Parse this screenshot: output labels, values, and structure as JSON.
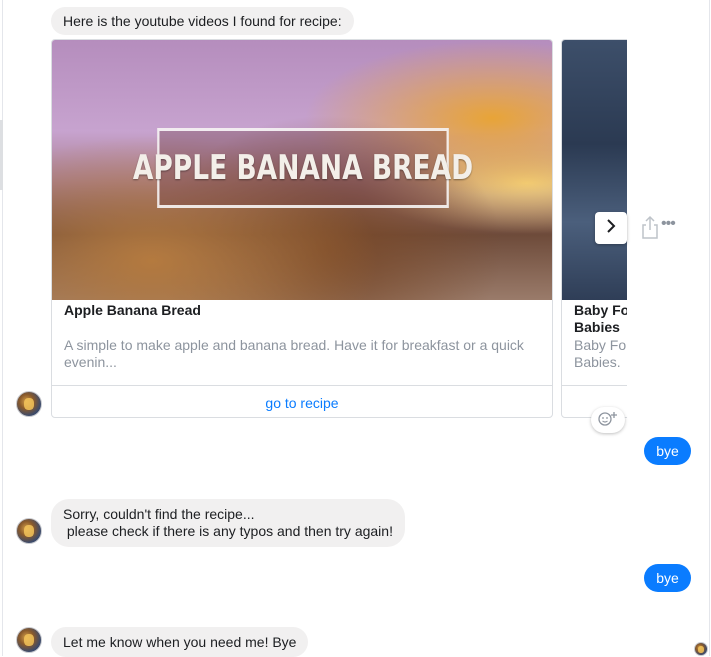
{
  "colors": {
    "incoming_bubble": "#f1f0f0",
    "outgoing_bubble": "#0a7cff",
    "link": "#0a7cff",
    "muted_text": "#8d949e"
  },
  "messages": {
    "intro": "Here is the youtube videos I found for recipe:",
    "bye_1": "bye",
    "not_found": "Sorry, couldn't find the recipe...\n please check if there is any typos and then try again!",
    "bye_2": "bye",
    "farewell": "Let me know when you need me! Bye"
  },
  "carousel": {
    "cards": [
      {
        "image_overlay_text": "APPLE BANANA BREAD",
        "title": "Apple Banana Bread",
        "description": "A simple to make apple and banana bread. Have it for breakfast or a quick evenin...",
        "action_label": "go to recipe"
      },
      {
        "title": "Baby Fo Babies",
        "description": "Baby Fo Babies."
      }
    ],
    "next_icon": "chevron-right-icon",
    "share_icon": "share-icon",
    "more_icon": "more-options-icon",
    "react_icon": "add-reaction-icon"
  }
}
